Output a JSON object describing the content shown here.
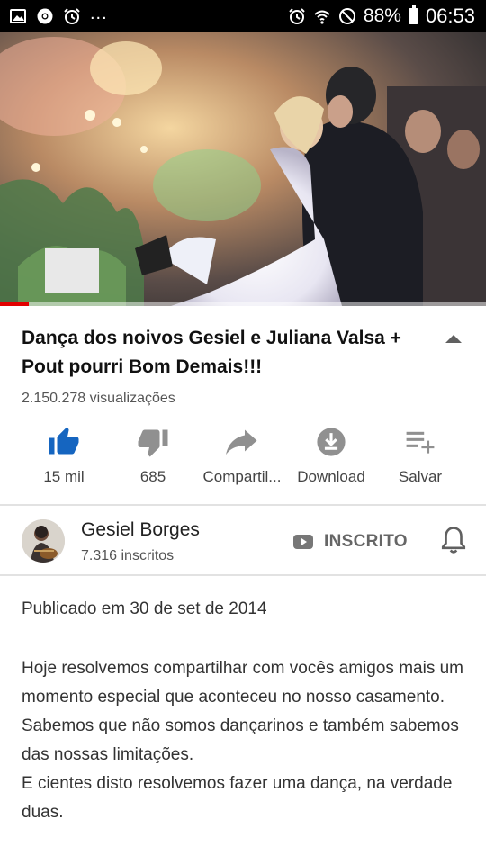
{
  "status_bar": {
    "time": "06:53",
    "battery": "88%",
    "left_icons": [
      "image-icon",
      "chrome-icon",
      "alarm-icon"
    ],
    "overflow": "...",
    "right_icons": [
      "alarm-icon",
      "wifi-icon",
      "do-not-disturb-icon",
      "battery-icon"
    ]
  },
  "video": {
    "progress": 0.06,
    "progress_color": "#e10000"
  },
  "title": "Dança dos noivos Gesiel e Juliana Valsa + Pout pourri Bom Demais!!!",
  "views": "2.150.278 visualizações",
  "actions": [
    {
      "label": "15 mil",
      "icon": "thumbs-up-icon",
      "color": "#1565c0"
    },
    {
      "label": "685",
      "icon": "thumbs-down-icon",
      "color": "#909090"
    },
    {
      "label": "Compartil...",
      "icon": "share-icon",
      "color": "#909090"
    },
    {
      "label": "Download",
      "icon": "download-icon",
      "color": "#909090"
    },
    {
      "label": "Salvar",
      "icon": "playlist-add-icon",
      "color": "#909090"
    }
  ],
  "channel": {
    "name": "Gesiel Borges",
    "subscribers": "7.316 inscritos",
    "subscribed_label": "INSCRITO",
    "subscribed_icon": "youtube-icon",
    "bell_icon": "bell-icon"
  },
  "description": {
    "published": "Publicado em 30 de set de 2014",
    "paragraphs": [
      "Hoje resolvemos compartilhar com vocês amigos mais um momento especial que aconteceu no nosso casamento.",
      "Sabemos que não somos dançarinos e também sabemos das nossas limitações.",
      "E cientes disto resolvemos fazer uma dança, na verdade duas."
    ]
  }
}
